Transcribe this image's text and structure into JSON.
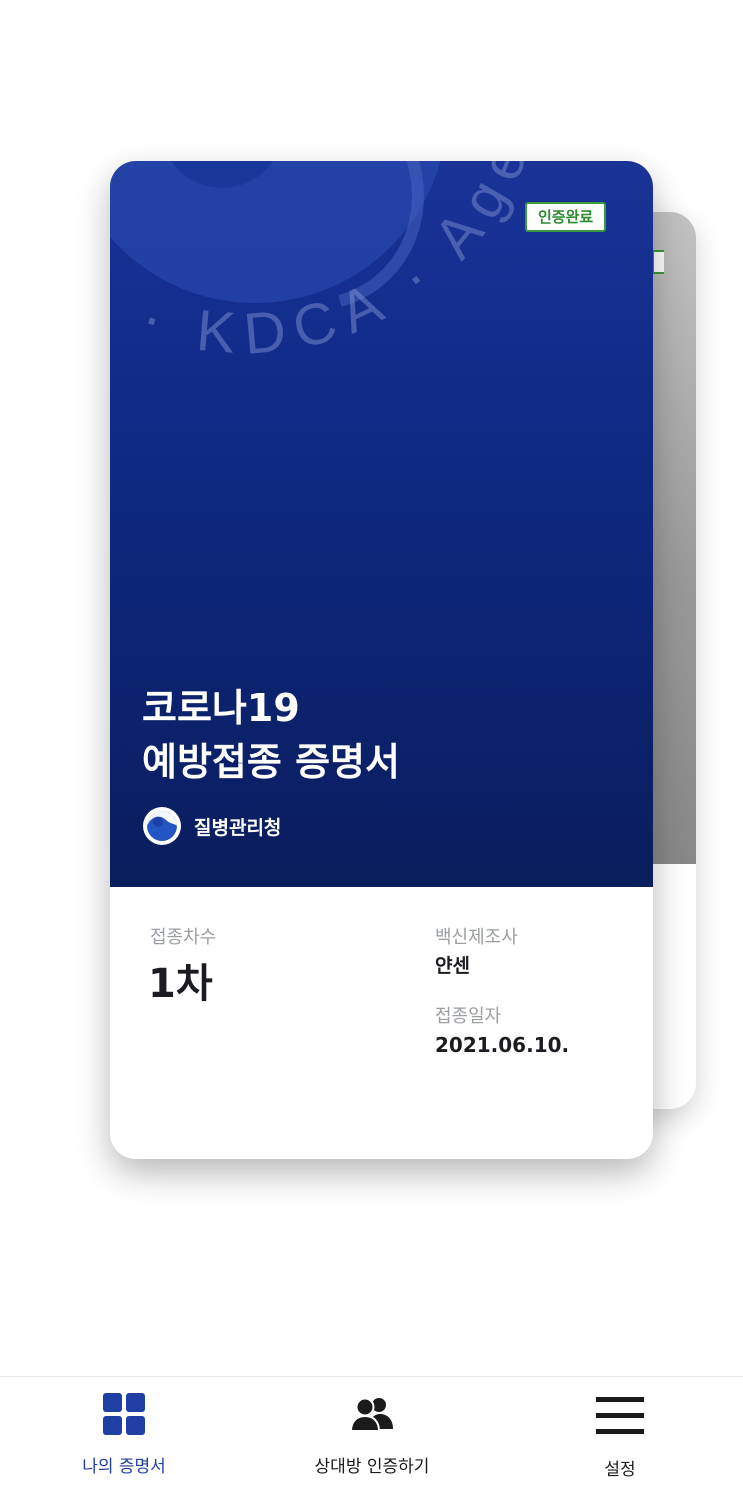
{
  "card": {
    "badge": "인증완료",
    "emblem_text": "· KDCA · Agency",
    "title_line1": "코로나19",
    "title_line2": "예방접종 증명서",
    "agency": "질병관리청",
    "dose_label": "접종차수",
    "dose_value": "1차",
    "maker_label": "백신제조사",
    "maker_value": "얀센",
    "date_label": "접종일자",
    "date_value": "2021.06.10."
  },
  "tabs": [
    {
      "label": "나의 증명서",
      "icon": "grid-icon",
      "active": true
    },
    {
      "label": "상대방 인증하기",
      "icon": "people-icon",
      "active": false
    },
    {
      "label": "설정",
      "icon": "menu-icon",
      "active": false
    }
  ],
  "colors": {
    "card_blue_top": "#1a3397",
    "card_blue_bottom": "#0a1d5c",
    "badge_green": "#2e8a31",
    "tab_active": "#1f3fa3",
    "tab_inactive": "#1b1b1b"
  }
}
